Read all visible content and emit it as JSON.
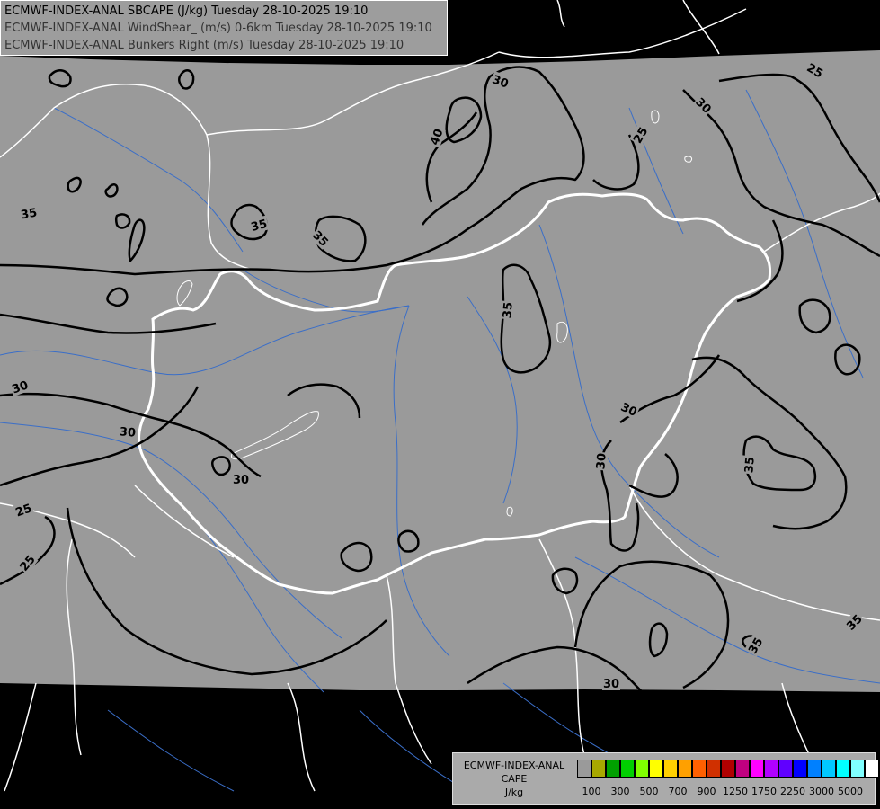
{
  "titles": [
    "ECMWF-INDEX-ANAL SBCAPE (J/kg) Tuesday 28-10-2025 19:10",
    "ECMWF-INDEX-ANAL WindShear_ (m/s) 0-6km Tuesday 28-10-2025 19:10",
    "ECMWF-INDEX-ANAL Bunkers Right (m/s) Tuesday 28-10-2025 19:10"
  ],
  "legend": {
    "model": "ECMWF-INDEX-ANAL",
    "parameter": "CAPE",
    "unit": "J/kg",
    "colors": [
      "#9a9a9a",
      "#a8a800",
      "#00a000",
      "#00d000",
      "#80ff00",
      "#ffff00",
      "#ffd000",
      "#ffa000",
      "#ff6000",
      "#d03000",
      "#b00000",
      "#c00080",
      "#ff00ff",
      "#b000ff",
      "#6000ff",
      "#0000ff",
      "#0080ff",
      "#00c8ff",
      "#00ffff",
      "#80ffff",
      "#ffffff"
    ],
    "ticks": [
      "100",
      "300",
      "500",
      "700",
      "900",
      "1250",
      "1750",
      "2250",
      "3000",
      "5000"
    ]
  },
  "contour_labels": [
    {
      "text": "35"
    },
    {
      "text": "30"
    },
    {
      "text": "40"
    },
    {
      "text": "25"
    },
    {
      "text": "30"
    },
    {
      "text": "25"
    },
    {
      "text": "35"
    },
    {
      "text": "35"
    },
    {
      "text": "35"
    },
    {
      "text": "35"
    },
    {
      "text": "30"
    },
    {
      "text": "30"
    },
    {
      "text": "30"
    },
    {
      "text": "30"
    },
    {
      "text": "25"
    },
    {
      "text": "25"
    },
    {
      "text": "30"
    },
    {
      "text": "35"
    },
    {
      "text": "35"
    },
    {
      "text": "30"
    }
  ],
  "colors": {
    "domain_fill": "#9a9a9a",
    "outside": "#000000",
    "border": "#ffffff",
    "river": "#3a6ec8",
    "contour": "#000000"
  }
}
